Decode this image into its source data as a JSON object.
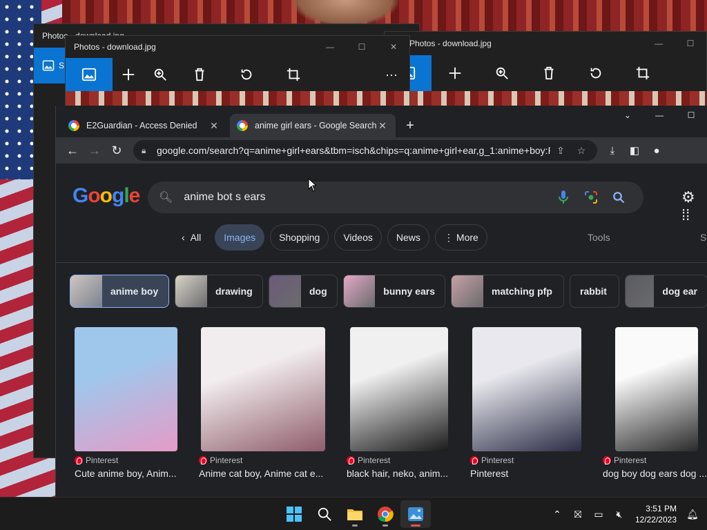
{
  "photos_back": {
    "title": "Photos - download.jpg",
    "left_button_initial": "S"
  },
  "photos_mid": {
    "title": "Photos - download.jpg"
  },
  "photos_right": {
    "title": "Photos - download.jpg"
  },
  "chrome": {
    "tabs": [
      {
        "label": "E2Guardian - Access Denied",
        "active": false
      },
      {
        "label": "anime girl ears - Google Search",
        "active": true
      }
    ],
    "url": "google.com/search?q=anime+girl+ears&tbm=isch&chips=q:anime+girl+ear,g_1:anime+boy:RHAH2i..."
  },
  "google": {
    "logo": "Google",
    "query": "anime bot s ears",
    "filters": [
      "All",
      "Images",
      "Shopping",
      "Videos",
      "News",
      "More"
    ],
    "selected_filter": "Images",
    "tools": "Tools",
    "right_cut": "S",
    "chips": [
      {
        "label": "anime boy",
        "selected": true,
        "thumb": "#cfc6c2"
      },
      {
        "label": "drawing",
        "selected": false,
        "thumb": "#d9d4c8"
      },
      {
        "label": "dog",
        "selected": false,
        "thumb": "#6c5a7a"
      },
      {
        "label": "bunny ears",
        "selected": false,
        "thumb": "#e3a9c8"
      },
      {
        "label": "matching pfp",
        "selected": false,
        "thumb": "#c7a0a8"
      },
      {
        "label": "rabbit",
        "selected": false,
        "thumb": null
      },
      {
        "label": "dog ear",
        "selected": false,
        "thumb": "#5a5a60"
      }
    ],
    "results": [
      {
        "source": "Pinterest",
        "title": "Cute anime boy, Anim...",
        "colors": [
          "#9fc7ec",
          "#e59bc6"
        ]
      },
      {
        "source": "Pinterest",
        "title": "Anime cat boy, Anime cat e...",
        "colors": [
          "#f1ecee",
          "#8e5c6a"
        ]
      },
      {
        "source": "Pinterest",
        "title": "black hair, neko, anim...",
        "colors": [
          "#f0f0f0",
          "#1a1a1a"
        ]
      },
      {
        "source": "Pinterest",
        "title": "Pinterest",
        "colors": [
          "#e8e8ee",
          "#2b2d45"
        ]
      },
      {
        "source": "Pinterest",
        "title": "dog boy dog ears dog ...",
        "colors": [
          "#fafafa",
          "#2a2a2a"
        ]
      }
    ]
  },
  "taskbar": {
    "apps": [
      "windows-start",
      "search",
      "file-explorer",
      "chrome",
      "photos"
    ],
    "time": "3:51 PM",
    "date": "12/22/2023"
  }
}
